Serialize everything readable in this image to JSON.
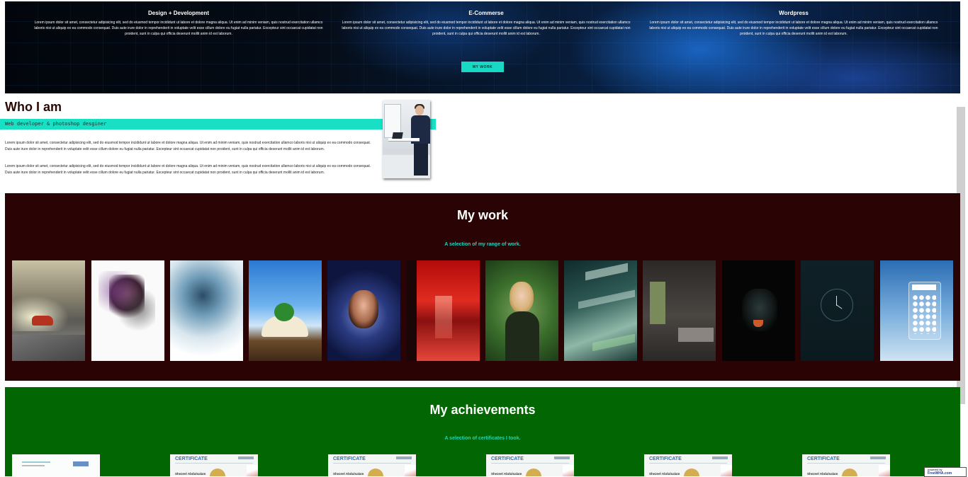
{
  "hero": {
    "services": [
      {
        "title": "Design + Development",
        "text": "Lorem ipsum dolor sit amet, consectetur adipisicing elit, sed do eiusmod tempor incididunt ut labore et dolore magna aliqua. Ut enim ad minim veniam, quis nostrud exercitation ullamco laboris nisi ut aliquip ex ea commodo consequat. Duis aute irure dolor in reprehenderit in voluptate velit esse cillum dolore eu fugiat nulla pariatur. Excepteur sint occaecat cupidatat non proident, sunt in culpa qui officia deserunt mollit anim id est laborum."
      },
      {
        "title": "E-Commerse",
        "text": "Lorem ipsum dolor sit amet, consectetur adipisicing elit, sed do eiusmod tempor incididunt ut labore et dolore magna aliqua. Ut enim ad minim veniam, quis nostrud exercitation ullamco laboris nisi ut aliquip ex ea commodo consequat. Duis aute irure dolor in reprehenderit in voluptate velit esse cillum dolore eu fugiat nulla pariatur. Excepteur sint occaecat cupidatat non proident, sunt in culpa qui officia deserunt mollit anim id est laborum."
      },
      {
        "title": "Wordpress",
        "text": "Lorem ipsum dolor sit amet, consectetur adipisicing elit, sed do eiusmod tempor incididunt ut labore et dolore magna aliqua. Ut enim ad minim veniam, quis nostrud exercitation ullamco laboris nisi ut aliquip ex ea commodo consequat. Duis aute irure dolor in reprehenderit in voluptate velit esse cillum dolore eu fugiat nulla pariatur. Excepteur sint occaecat cupidatat non proident, sunt in culpa qui officia deserunt mollit anim id est laborum."
      }
    ],
    "button_label": "MY WORK"
  },
  "about": {
    "title": "Who I am",
    "subtitle": "Web developer & photoshop desginer",
    "paragraphs": [
      "Lorem ipsum dolor sit amet, consectetur adipisicing elit, sed do eiusmod tempor incididunt ut labore et dolore magna aliqua. Ut enim ad minim veniam, quis nostrud exercitation ullamco laboris nisi ut aliquip ex ea commodo consequat. Duis aute irure dolor in reprehenderit in voluptate velit esse cillum dolore eu fugiat nulla pariatur. Excepteur sint occaecat cupidatat non proident, sunt in culpa qui officia deserunt mollit anim id est laborum.",
      "Lorem ipsum dolor sit amet, consectetur adipisicing elit, sed do eiusmod tempor incididunt ut labore et dolore magna aliqua. Ut enim ad minim veniam, quis nostrud exercitation ullamco laboris nisi ut aliquip ex ea commodo consequat. Duis aute irure dolor in reprehenderit in voluptate velit esse cillum dolore eu fugiat nulla pariatur. Excepteur sint occaecat cupidatat non proident, sunt in culpa qui officia deserunt mollit anim id est laborum."
    ]
  },
  "work": {
    "title": "My work",
    "subtitle": "A selection of my range of work.",
    "thumbnails": [
      "car-tunnel",
      "paint-splash-face",
      "shattered-portrait",
      "book-island",
      "portrait-frame",
      "red-forest",
      "blonde-woman",
      "financial-text",
      "modern-interior",
      "black-panther",
      "clock",
      "calculator-app"
    ]
  },
  "achievements": {
    "title": "My achievements",
    "subtitle": "A selection of certificates I took.",
    "certificates": [
      {
        "title": ""
      },
      {
        "title": "CERTIFICATE",
        "name": "Shezeel Abdulsalam"
      },
      {
        "title": "CERTIFICATE",
        "name": "Shezeel Abdulsalam"
      },
      {
        "title": "CERTIFICATE",
        "name": "Shezeel Abdulsalam"
      },
      {
        "title": "CERTIFICATE",
        "name": "Shezeel Abdulsalam"
      },
      {
        "title": "CERTIFICATE",
        "name": "Shezeel Abdulsalam"
      }
    ]
  },
  "badge": {
    "line1": "powered by",
    "line2": "FreeWHA.com"
  },
  "colors": {
    "accent": "#18d9c3",
    "work_bg": "#2a0404",
    "achievements_bg": "#026602",
    "title_dark": "#2a0805"
  }
}
